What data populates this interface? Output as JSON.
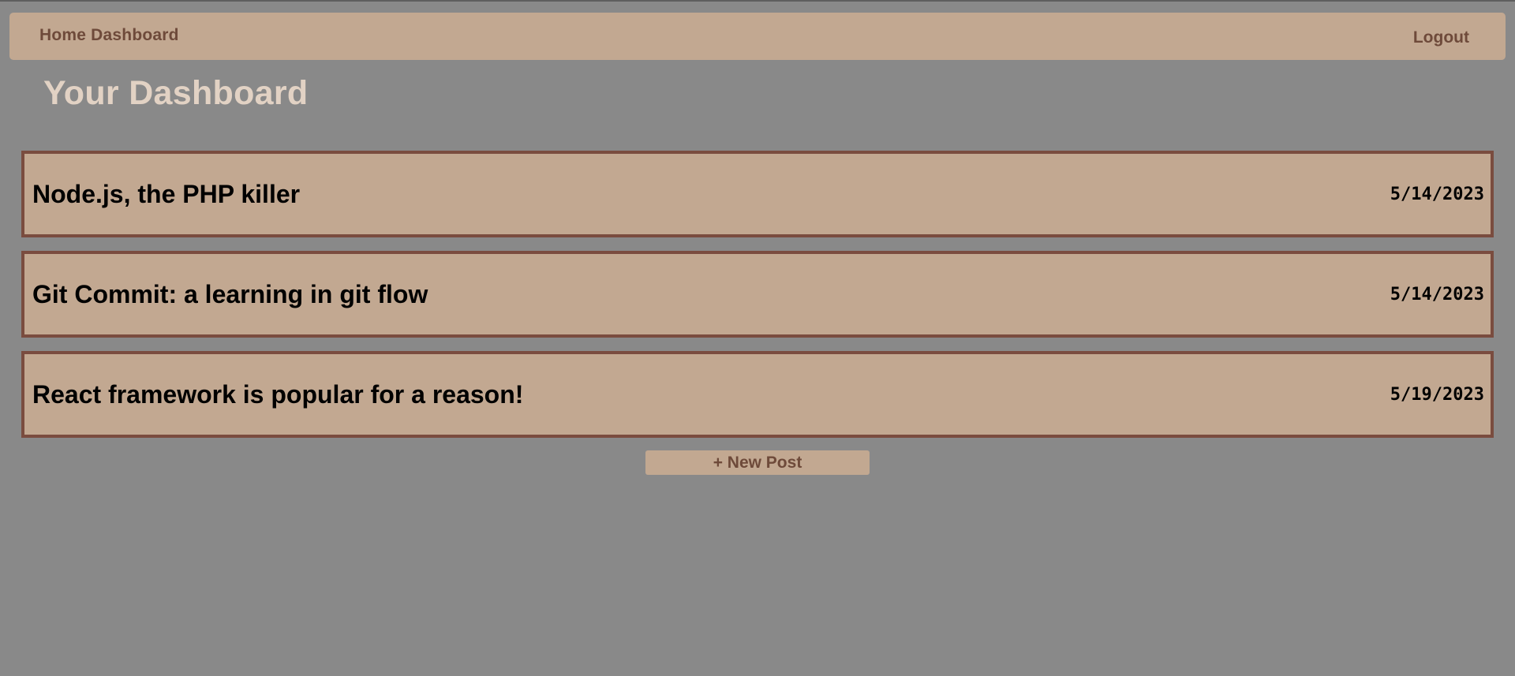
{
  "navbar": {
    "home_label": "Home Dashboard",
    "logout_label": "Logout"
  },
  "page": {
    "title": "Your Dashboard"
  },
  "posts": [
    {
      "title": "Node.js, the PHP killer",
      "date": "5/14/2023"
    },
    {
      "title": "Git Commit: a learning in git flow",
      "date": "5/14/2023"
    },
    {
      "title": "React framework is popular for a reason!",
      "date": "5/19/2023"
    }
  ],
  "actions": {
    "new_post_label": "+ New Post"
  },
  "colors": {
    "background": "#898989",
    "card": "#c2a891",
    "card_border": "#7a4c3f",
    "accent_text": "#6e4a3a",
    "title_text": "#e2d2c4"
  }
}
